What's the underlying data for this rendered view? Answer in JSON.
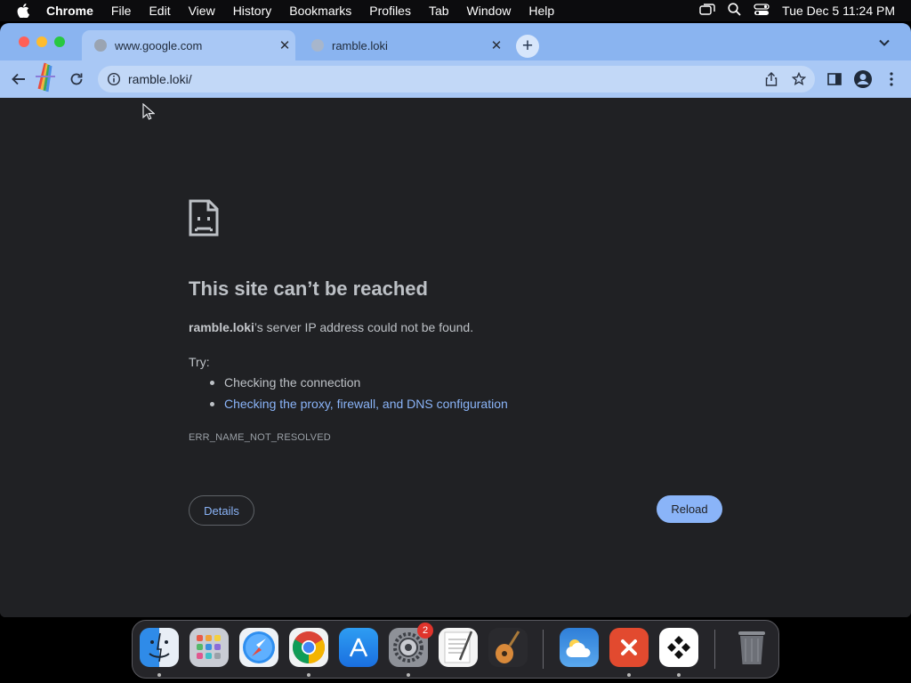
{
  "menubar": {
    "app_name": "Chrome",
    "items": [
      "File",
      "Edit",
      "View",
      "History",
      "Bookmarks",
      "Profiles",
      "Tab",
      "Window",
      "Help"
    ],
    "clock": "Tue Dec 5  11:24 PM"
  },
  "tabs": [
    {
      "title": "www.google.com",
      "close": "✕"
    },
    {
      "title": "ramble.loki",
      "close": "✕"
    }
  ],
  "new_tab_label": "+",
  "omnibox": {
    "url": "ramble.loki/"
  },
  "error_page": {
    "heading": "This site can’t be reached",
    "host": "ramble.loki",
    "message_rest": "’s server IP address could not be found.",
    "try_label": "Try:",
    "suggestions": [
      "Checking the connection",
      "Checking the proxy, firewall, and DNS configuration"
    ],
    "error_code": "ERR_NAME_NOT_RESOLVED",
    "details_label": "Details",
    "reload_label": "Reload"
  },
  "dock": {
    "apps": [
      "finder",
      "launchpad",
      "safari",
      "chrome",
      "app-store",
      "system-settings",
      "textedit",
      "garageband",
      "weather",
      "remote-desktop",
      "tuple",
      "trash"
    ],
    "system_settings_badge": "2"
  },
  "colors": {
    "tab_strip": "#8ab4f0",
    "toolbar": "#a9c8f5",
    "page_background": "#202124",
    "link": "#8ab4f8",
    "reload_button": "#8ab4f8"
  }
}
